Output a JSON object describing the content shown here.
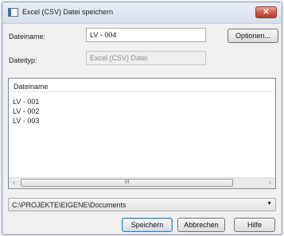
{
  "window": {
    "title": "Excel (CSV) Datei speichern",
    "close_symbol": "✕"
  },
  "form": {
    "filename_label": "Dateiname:",
    "filename_value": "LV - 004",
    "options_label": "Optionen...",
    "filetype_label": "Dateityp:",
    "filetype_value": "Excel (CSV) Datei"
  },
  "list": {
    "column_header": "Dateiname",
    "items": [
      "LV - 001",
      "LV - 002",
      "LV - 003"
    ]
  },
  "scrollbar": {
    "left": "‹",
    "right": "›",
    "grip": "III"
  },
  "path": {
    "value": "C:\\PROJEKTE\\EIGENE\\Documents",
    "arrow": "▼"
  },
  "buttons": {
    "save": "Speichern",
    "cancel": "Abbrechen",
    "help": "Hilfe"
  }
}
